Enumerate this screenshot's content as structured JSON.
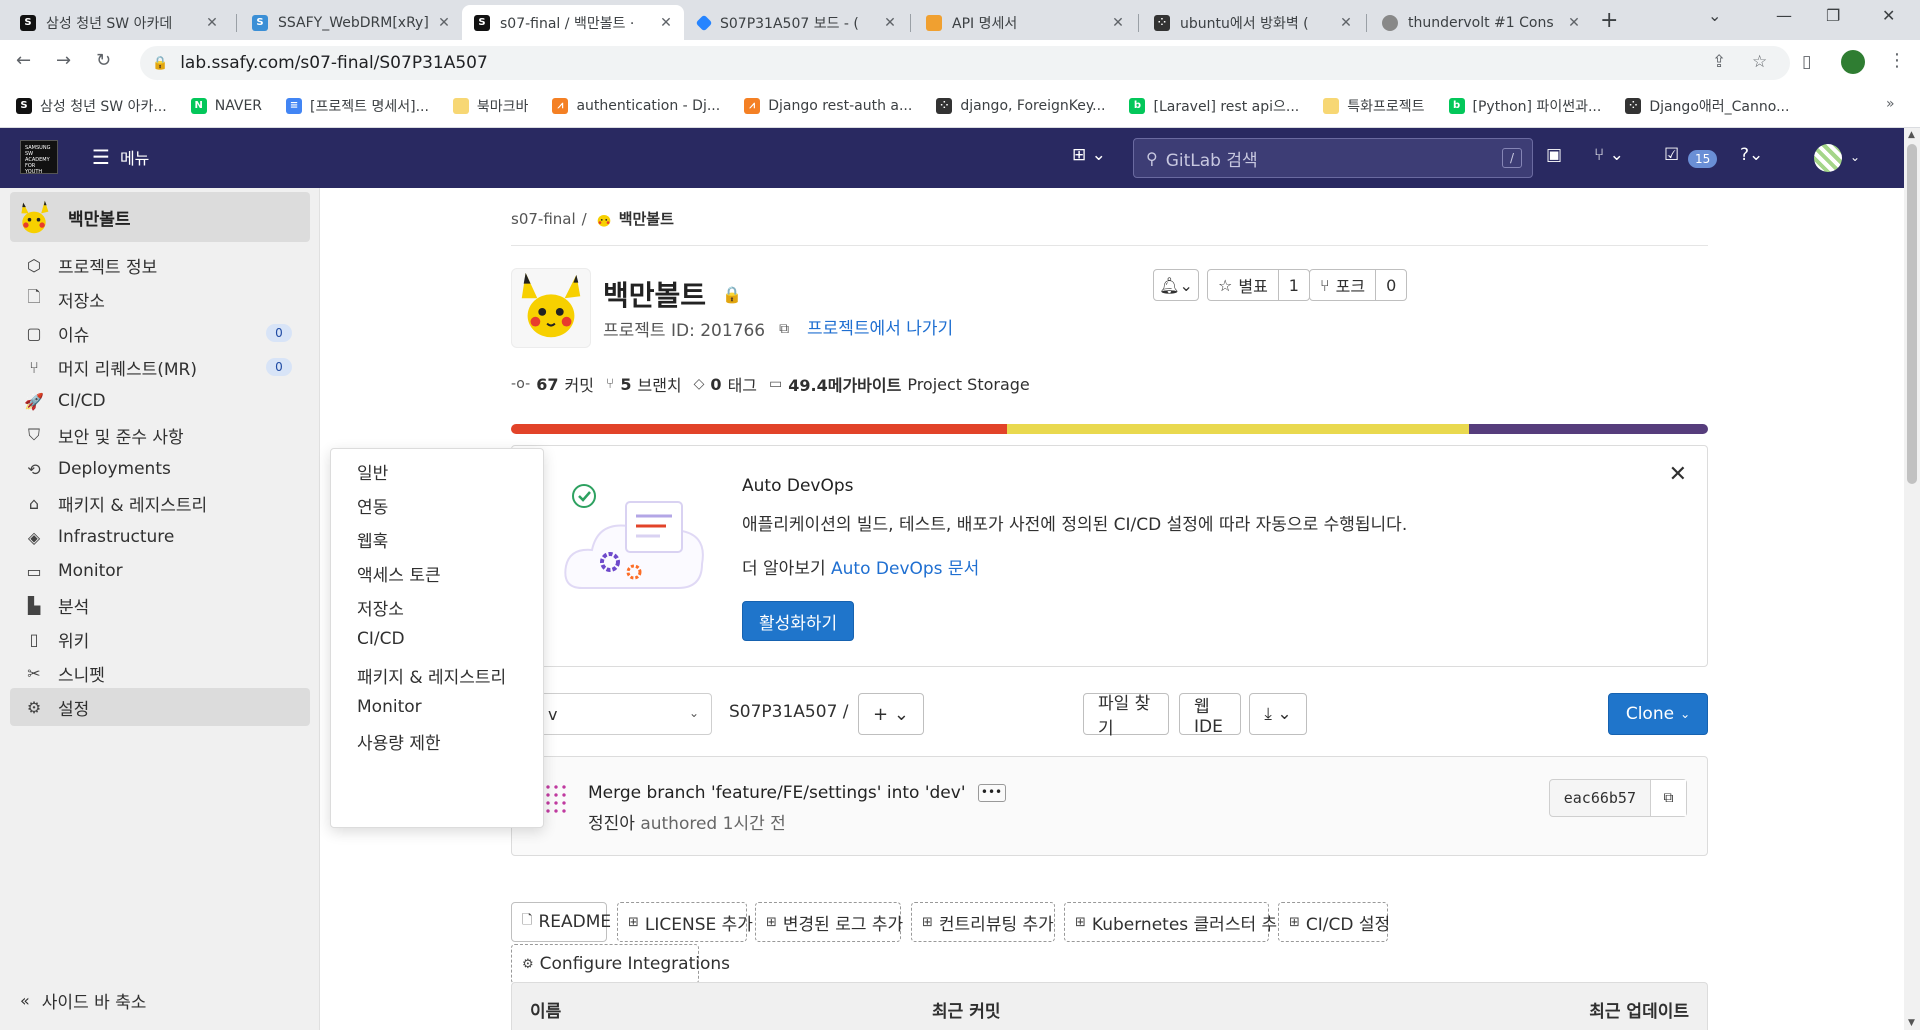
{
  "browser": {
    "tabs": [
      {
        "title": "삼성 청년 SW 아카데",
        "color": "#111111"
      },
      {
        "title": "SSAFY_WebDRM[xRy]",
        "color": "#3b8fd6"
      },
      {
        "title": "s07-final / 백만볼트 ·",
        "color": "#111111"
      },
      {
        "title": "S07P31A507 보드 - (",
        "color": "#2684ff"
      },
      {
        "title": "API 명세서",
        "color": "#f0a030"
      },
      {
        "title": "ubuntu에서 방화벽 (",
        "color": "#333333"
      },
      {
        "title": "thundervolt #1 Cons",
        "color": "#888888"
      }
    ],
    "url": "lab.ssafy.com/s07-final/S07P31A507",
    "bookmarks": [
      {
        "label": "삼성 청년 SW 아카...",
        "color": "#111111"
      },
      {
        "label": "NAVER",
        "color": "#03c75a"
      },
      {
        "label": "[프로젝트 명세서]...",
        "color": "#4285f4"
      },
      {
        "label": "북마크바",
        "color": "#f7d774"
      },
      {
        "label": "authentication - Dj...",
        "color": "#f48024"
      },
      {
        "label": "Django rest-auth a...",
        "color": "#f48024"
      },
      {
        "label": "django, ForeignKey...",
        "color": "#333333"
      },
      {
        "label": "[Laravel] rest api으...",
        "color": "#03c75a"
      },
      {
        "label": "특화프로젝트",
        "color": "#f7d774"
      },
      {
        "label": "[Python] 파이썬과...",
        "color": "#03c75a"
      },
      {
        "label": "Django애러_Canno...",
        "color": "#333333"
      }
    ]
  },
  "gitlab": {
    "menu_label": "메뉴",
    "search_placeholder": "GitLab 검색",
    "search_shortcut": "/",
    "todo_count": "15"
  },
  "sidebar": {
    "project_name": "백만볼트",
    "items": [
      {
        "label": "프로젝트 정보",
        "icon": "info-icon"
      },
      {
        "label": "저장소",
        "icon": "repository-icon"
      },
      {
        "label": "이슈",
        "icon": "issues-icon",
        "count": "0"
      },
      {
        "label": "머지 리퀘스트(MR)",
        "icon": "merge-request-icon",
        "count": "0"
      },
      {
        "label": "CI/CD",
        "icon": "rocket-icon"
      },
      {
        "label": "보안 및 준수 사항",
        "icon": "shield-icon"
      },
      {
        "label": "Deployments",
        "icon": "deployments-icon"
      },
      {
        "label": "패키지 & 레지스트리",
        "icon": "package-icon"
      },
      {
        "label": "Infrastructure",
        "icon": "infrastructure-icon"
      },
      {
        "label": "Monitor",
        "icon": "monitor-icon"
      },
      {
        "label": "분석",
        "icon": "analytics-icon"
      },
      {
        "label": "위키",
        "icon": "wiki-icon"
      },
      {
        "label": "스니펫",
        "icon": "snippet-icon"
      },
      {
        "label": "설정",
        "icon": "settings-icon"
      }
    ],
    "collapse_label": "사이드 바 축소"
  },
  "flyout": {
    "items": [
      "일반",
      "연동",
      "웹훅",
      "액세스 토큰",
      "저장소",
      "CI/CD",
      "패키지 & 레지스트리",
      "Monitor",
      "사용량 제한"
    ]
  },
  "main": {
    "breadcrumb_group": "s07-final",
    "breadcrumb_sep": "/",
    "breadcrumb_project": "백만볼트",
    "title": "백만볼트",
    "project_id": "프로젝트 ID: 201766",
    "leave_label": "프로젝트에서 나가기",
    "star_label": "별표",
    "star_count": "1",
    "fork_label": "포크",
    "fork_count": "0",
    "stats": {
      "commits_num": "67",
      "commits_label": "커밋",
      "branches_num": "5",
      "branches_label": "브랜치",
      "tags_num": "0",
      "tags_label": "태그",
      "storage_num": "49.4메가바이트",
      "storage_label": "Project Storage"
    },
    "languages": [
      {
        "color": "#e24329",
        "share": 0.414
      },
      {
        "color": "#e9d94f",
        "share": 0.386
      },
      {
        "color": "#563d7c",
        "share": 0.2
      }
    ],
    "devops": {
      "title": "Auto DevOps",
      "desc": "애플리케이션의 빌드, 테스트, 배포가 사전에 정의된 CI/CD 설정에 따라 자동으로 수행됩니다.",
      "more_prefix": "더 알아보기",
      "more_link": "Auto DevOps 문서",
      "button": "활성화하기"
    },
    "branch_value": "v",
    "path": "S07P31A507  /",
    "find_file": "파일 찾기",
    "web_ide": "웹 IDE",
    "clone": "Clone",
    "commit": {
      "message": "Merge branch 'feature/FE/settings' into 'dev'",
      "author": "정진아",
      "authored": "authored 1시간 전",
      "sha": "eac66b57"
    },
    "quick_actions": [
      "README",
      "LICENSE 추가",
      "변경된 로그 추가",
      "컨트리뷰팅 추가",
      "Kubernetes 클러스터 추가",
      "CI/CD 설정",
      "Configure Integrations"
    ],
    "table": {
      "name": "이름",
      "last_commit": "최근 커밋",
      "last_update": "최근 업데이트"
    }
  }
}
